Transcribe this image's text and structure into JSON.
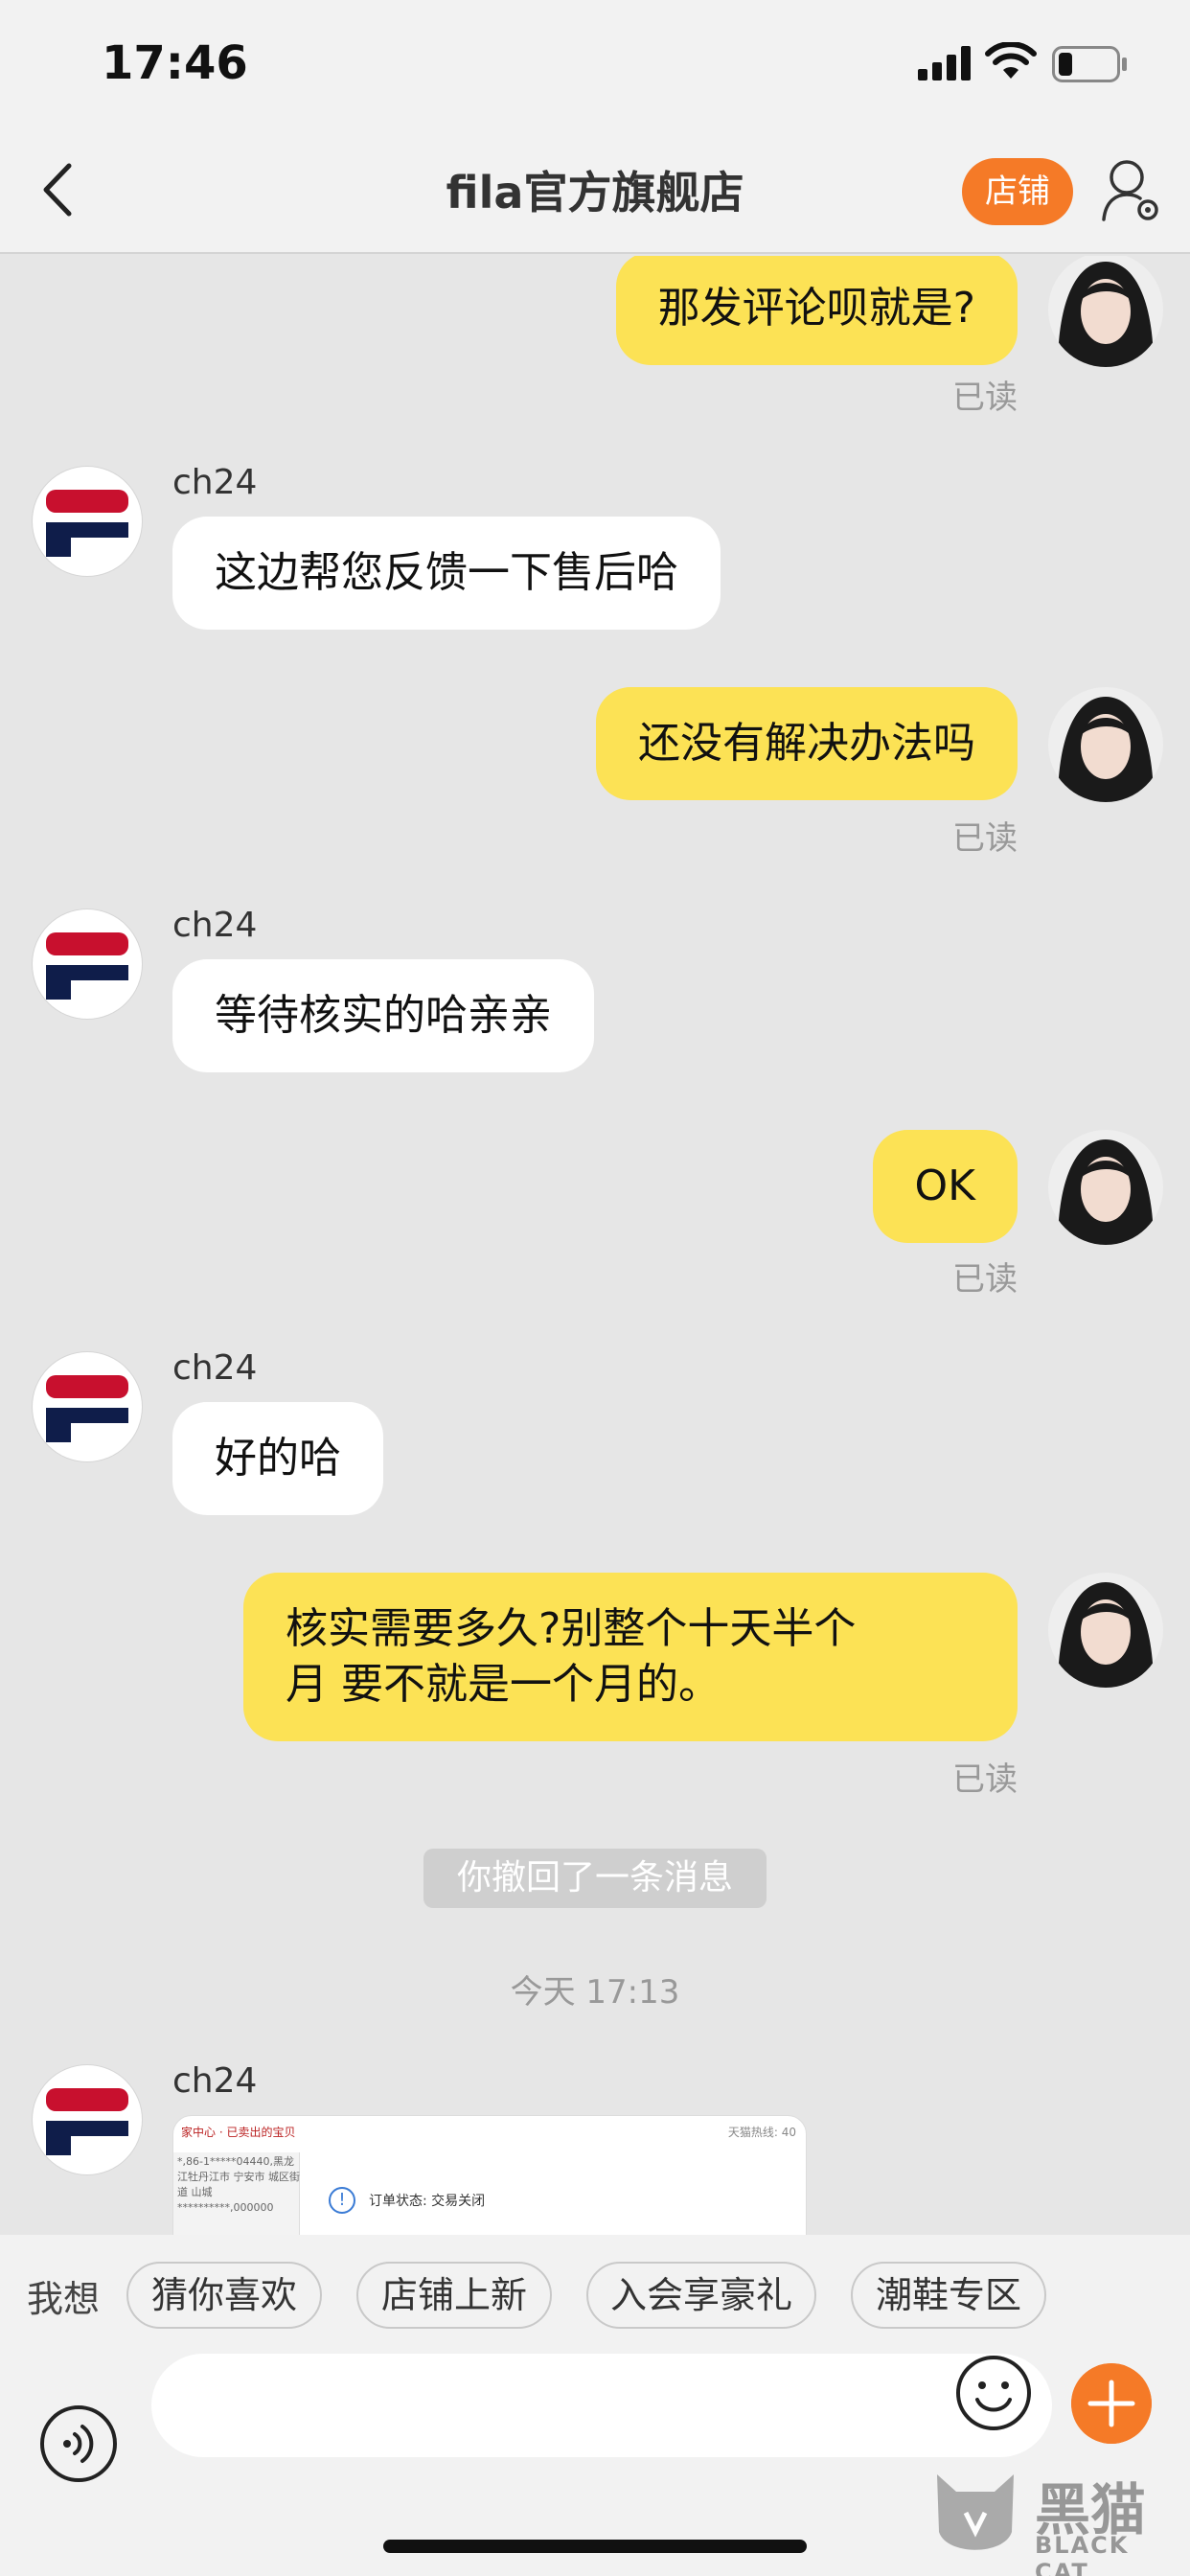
{
  "status_bar": {
    "time": "17:46"
  },
  "nav": {
    "title": "fila官方旗舰店",
    "store_button": "店铺"
  },
  "messages": [
    {
      "side": "right",
      "text": "那发评论呗就是?",
      "read": "已读"
    },
    {
      "side": "left",
      "sender": "ch24",
      "text": "这边帮您反馈一下售后哈"
    },
    {
      "side": "right",
      "text": "还没有解决办法吗",
      "read": "已读"
    },
    {
      "side": "left",
      "sender": "ch24",
      "text": "等待核实的哈亲亲"
    },
    {
      "side": "right",
      "text": "OK",
      "read": "已读"
    },
    {
      "side": "left",
      "sender": "ch24",
      "text": "好的哈"
    },
    {
      "side": "right",
      "text_line1": "核实需要多久?别整个十天半个",
      "text_line2": "月 要不就是一个月的。",
      "read": "已读"
    },
    {
      "side": "system",
      "text": "你撤回了一条消息"
    },
    {
      "side": "time",
      "text": "今天 17:13"
    },
    {
      "side": "left",
      "sender": "ch24",
      "type": "image",
      "image_text": {
        "header_left": "家中心 · 已卖出的宝贝",
        "header_right": "天猫热线: 40",
        "sidebar": "*,86-1*****04440,黑龙江牡丹江市 宁安市 城区街道 山城**********,000000",
        "status": "订单状态: 交易关闭"
      }
    }
  ],
  "suggest": {
    "label": "我想",
    "chips": [
      "猜你喜欢",
      "店铺上新",
      "入会享豪礼",
      "潮鞋专区"
    ]
  },
  "input": {
    "placeholder": ""
  },
  "watermark": {
    "cn": "黑猫",
    "en": "BLACK CAT"
  },
  "colors": {
    "accent": "#f57a27",
    "bubble_self": "#fce255",
    "bubble_other": "#ffffff",
    "background": "#e6e6e6",
    "fila_red": "#c8102e",
    "fila_navy": "#0f1d4a"
  }
}
